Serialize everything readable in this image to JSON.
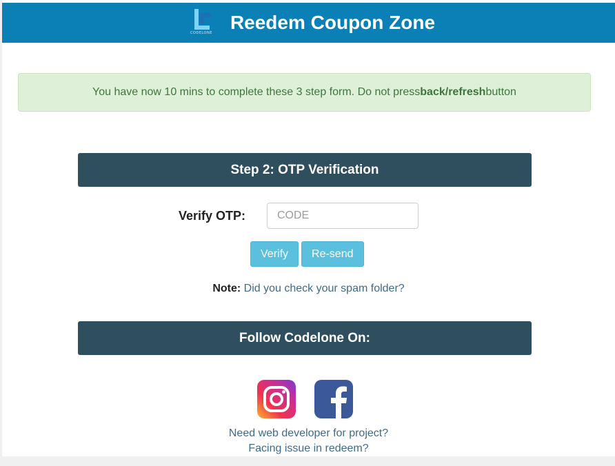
{
  "header": {
    "title": "Reedem Coupon Zone",
    "logo_caption": "CODELONE",
    "bg_color": "#0b80b7"
  },
  "alert": {
    "text_before": "You have now 10 mins to complete these 3 step form. Do not press ",
    "emphasis": "back/refresh",
    "text_after": " button"
  },
  "step": {
    "heading": "Step 2: OTP Verification",
    "otp_label": "Verify OTP:",
    "otp_placeholder": "CODE",
    "otp_value": "",
    "verify_label": "Verify",
    "resend_label": "Re-send",
    "note_label": "Note:",
    "note_text": " Did you check your spam folder?"
  },
  "follow": {
    "heading": "Follow Codelone On:",
    "icons": [
      "instagram-icon",
      "facebook-icon"
    ],
    "link_developer": "Need web developer for project?",
    "link_issue": "Facing issue in redeem?"
  },
  "colors": {
    "panel_header": "#2f4f5f",
    "button": "#5bc0de",
    "alert_bg": "#dff0d8",
    "link": "#3e6a8a"
  }
}
